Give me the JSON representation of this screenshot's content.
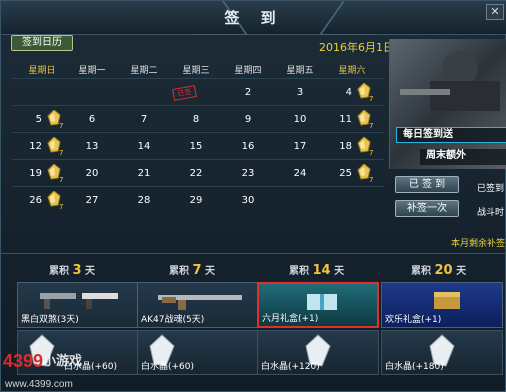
{
  "title": "签 到",
  "calendar_badge": "签到日历",
  "date": "2016年6月1日",
  "weekdays": [
    "星期日",
    "星期一",
    "星期二",
    "星期三",
    "星期四",
    "星期五",
    "星期六"
  ],
  "stamp": "已签",
  "weeks": [
    [
      "",
      "",
      "",
      "",
      "2",
      "3",
      "4"
    ],
    [
      "5",
      "6",
      "7",
      "8",
      "9",
      "10",
      "11"
    ],
    [
      "12",
      "13",
      "14",
      "15",
      "16",
      "17",
      "18"
    ],
    [
      "19",
      "20",
      "21",
      "22",
      "23",
      "24",
      "25"
    ],
    [
      "26",
      "27",
      "28",
      "29",
      "30",
      "",
      ""
    ]
  ],
  "promo": {
    "line1": "每日签到送",
    "line2": "周末额外"
  },
  "buttons": {
    "signed": "已 签 到",
    "makeup": "补签一次"
  },
  "side": {
    "signed_to": "已签到",
    "battle": "战斗时"
  },
  "remaining": "本月剩余补签",
  "cumulative": [
    {
      "prefix": "累积",
      "days": "3",
      "unit": "天"
    },
    {
      "prefix": "累积",
      "days": "7",
      "unit": "天"
    },
    {
      "prefix": "累积",
      "days": "14",
      "unit": "天"
    },
    {
      "prefix": "累积",
      "days": "20",
      "unit": "天"
    }
  ],
  "rewards": [
    "黑白双煞(3天)",
    "AK47战魂(5天)",
    "六月礼盒(+1)",
    "欢乐礼盒(+1)"
  ],
  "crystals": [
    "白水晶(+60)",
    "白水晶(+60)",
    "白水晶(+120)",
    "白水晶(+180)"
  ],
  "watermark": {
    "brand": "4399",
    "site": "小游戏",
    "url": "www.4399.com"
  },
  "colors": {
    "gold": "#e6d43a",
    "accent_red": "#e0302a",
    "blue_border": "#2ab3e0"
  }
}
